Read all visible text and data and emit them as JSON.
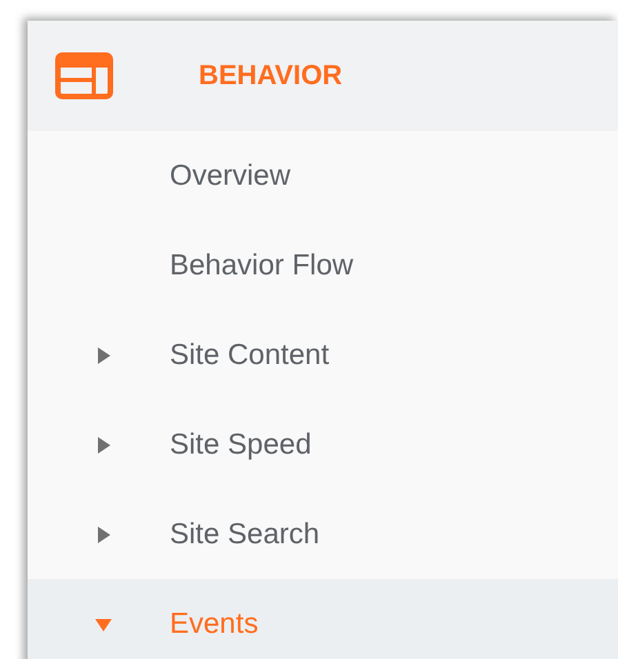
{
  "section": {
    "title": "BEHAVIOR"
  },
  "items": [
    {
      "label": "Overview",
      "kind": "link",
      "selected": false
    },
    {
      "label": "Behavior Flow",
      "kind": "link",
      "selected": false
    },
    {
      "label": "Site Content",
      "kind": "group",
      "expanded": false,
      "selected": false
    },
    {
      "label": "Site Speed",
      "kind": "group",
      "expanded": false,
      "selected": false
    },
    {
      "label": "Site Search",
      "kind": "group",
      "expanded": false,
      "selected": false
    },
    {
      "label": "Events",
      "kind": "group",
      "expanded": true,
      "selected": true
    }
  ]
}
